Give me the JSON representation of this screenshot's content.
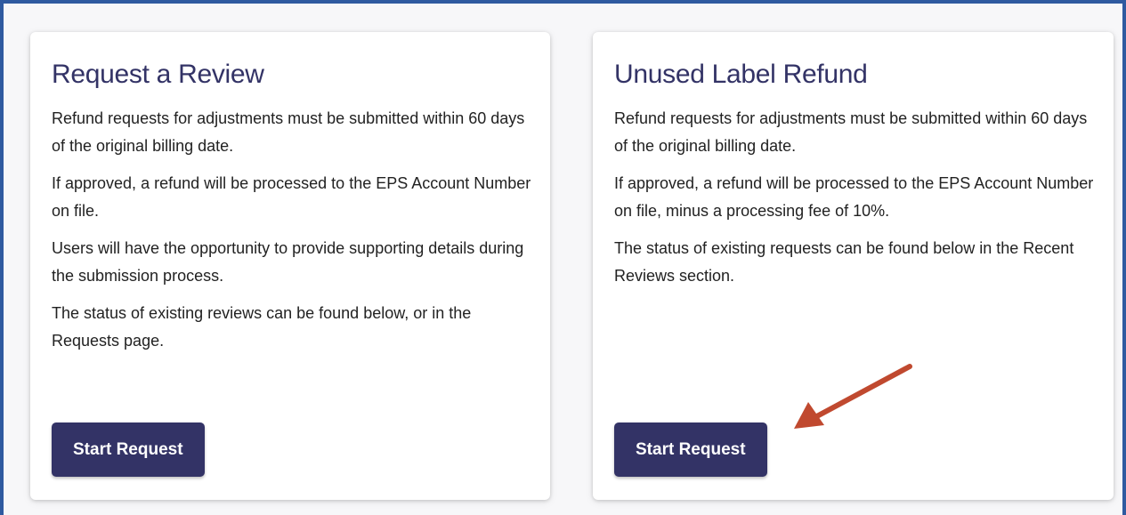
{
  "cards": [
    {
      "title": "Request a Review",
      "paragraphs": [
        "Refund requests for adjustments must be submitted within 60 days of the original billing date.",
        "If approved, a refund will be processed to the EPS Account Number on file.",
        "Users will have the opportunity to provide supporting details during the submission process.",
        "The status of existing reviews can be found below, or in the Requests page."
      ],
      "button_label": "Start Request"
    },
    {
      "title": "Unused Label Refund",
      "paragraphs": [
        "Refund requests for adjustments must be submitted within 60 days of the original billing date.",
        "If approved, a refund will be processed to the EPS Account Number on file, minus a processing fee of 10%.",
        "The status of existing requests can be found below in the Recent Reviews section."
      ],
      "button_label": "Start Request"
    }
  ],
  "colors": {
    "title": "#333366",
    "button_bg": "#333366",
    "frame_border": "#2f5aa0",
    "annotation_arrow": "#c0492f"
  },
  "annotation": {
    "icon": "arrow-annotation-icon"
  }
}
